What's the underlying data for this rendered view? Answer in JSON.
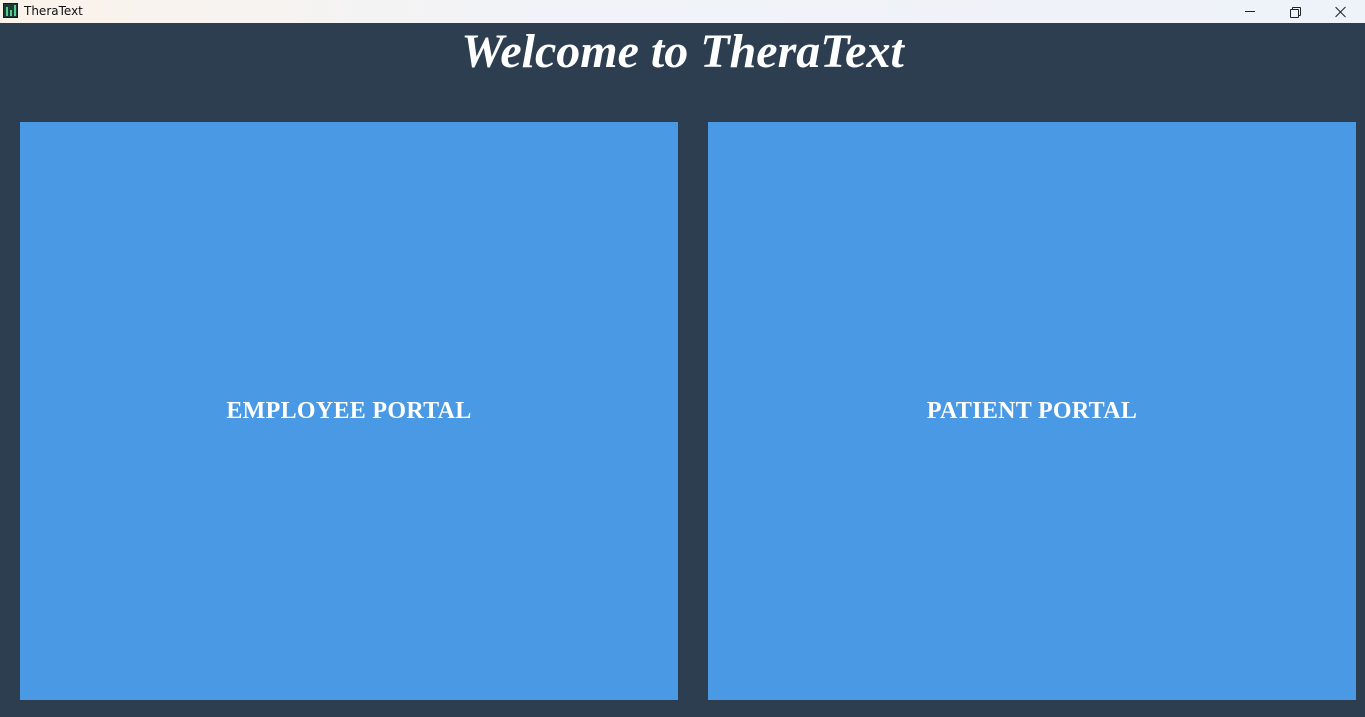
{
  "window": {
    "title": "TheraText",
    "app_icon": "therattext-app-icon",
    "controls": {
      "minimize_icon": "minimize-icon",
      "maximize_icon": "restore-icon",
      "close_icon": "close-icon"
    }
  },
  "main": {
    "heading": "Welcome to TheraText",
    "portals": [
      {
        "label": "EMPLOYEE PORTAL"
      },
      {
        "label": "PATIENT PORTAL"
      }
    ]
  },
  "colors": {
    "background": "#2c3e50",
    "portal_button": "#4a99e5",
    "text": "#ffffff"
  }
}
